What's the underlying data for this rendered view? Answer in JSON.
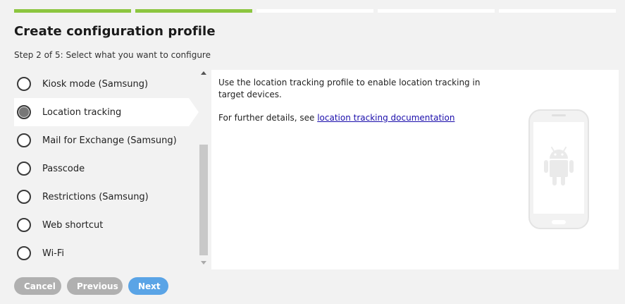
{
  "progress": {
    "total_steps": 5,
    "completed_steps": 2
  },
  "header": {
    "title": "Create configuration profile",
    "subtitle": "Step 2 of 5: Select what you want to configure"
  },
  "options": [
    {
      "label": "Kiosk mode (Samsung)",
      "selected": false
    },
    {
      "label": "Location tracking",
      "selected": true
    },
    {
      "label": "Mail for Exchange (Samsung)",
      "selected": false
    },
    {
      "label": "Passcode",
      "selected": false
    },
    {
      "label": "Restrictions (Samsung)",
      "selected": false
    },
    {
      "label": "Web shortcut",
      "selected": false
    },
    {
      "label": "Wi-Fi",
      "selected": false
    }
  ],
  "detail": {
    "description": "Use the location tracking profile to enable location tracking in target devices.",
    "details_prefix": "For further details, see ",
    "details_link": "location tracking documentation",
    "illustration_icon": "android-phone-icon"
  },
  "buttons": {
    "cancel": "Cancel",
    "previous": "Previous",
    "next": "Next"
  },
  "colors": {
    "progress_done": "#8cc63f",
    "progress_pending": "#ffffff",
    "primary_button": "#5aa4e6",
    "secondary_button": "#b0b0b0",
    "link": "#1a0dab"
  }
}
